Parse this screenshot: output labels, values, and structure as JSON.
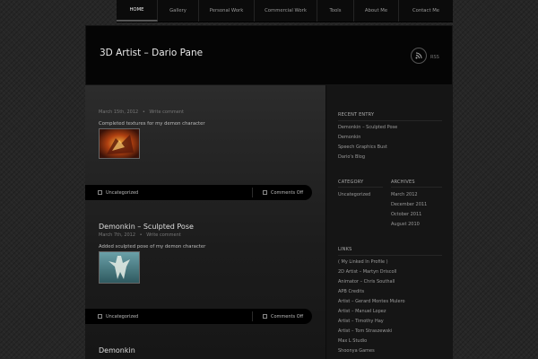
{
  "nav": {
    "items": [
      {
        "label": "HOME",
        "active": true
      },
      {
        "label": "Gallery",
        "active": false
      },
      {
        "label": "Personal Work",
        "active": false
      },
      {
        "label": "Commercial Work",
        "active": false
      },
      {
        "label": "Tools",
        "active": false
      },
      {
        "label": "About Me",
        "active": false
      },
      {
        "label": "Contact Me",
        "active": false
      }
    ]
  },
  "header": {
    "site_title": "3D Artist – Dario Pane",
    "rss_label": "RSS"
  },
  "posts": [
    {
      "title": "",
      "date": "March 15th, 2012",
      "comment_link": "Write comment",
      "excerpt": "Completed textures for my demon character",
      "thumb_icon": "demon-character-thumbnail",
      "category": "Uncategorized",
      "comments": "Comments Off"
    },
    {
      "title": "Demonkin – Sculpted Pose",
      "date": "March 7th, 2012",
      "comment_link": "Write comment",
      "excerpt": "Added sculpted pose of my demon character",
      "thumb_icon": "sculpted-pose-thumbnail",
      "category": "Uncategorized",
      "comments": "Comments Off"
    },
    {
      "title": "Demonkin"
    }
  ],
  "sidebar": {
    "recent_entry": {
      "heading": "RECENT ENTRY",
      "items": [
        "Demonkin – Sculpted Pose",
        "Demonkin",
        "Speech Graphics Bust",
        "Dario's Blog"
      ]
    },
    "category": {
      "heading": "CATEGORY",
      "items": [
        "Uncategorized"
      ]
    },
    "archives": {
      "heading": "ARCHIVES",
      "items": [
        "March 2012",
        "December 2011",
        "October 2011",
        "August 2010"
      ]
    },
    "links": {
      "heading": "LINKS",
      "items": [
        "( My Linked In Profile )",
        "2D Artist – Martyn Driscoll",
        "Animator – Chris Southall",
        "APB Credits",
        "Artist – Gerard Montes Mulero",
        "Artist – Manuel Lopez",
        "Artist – Timothy Hay",
        "Artist – Tom Straszewski",
        "Max L Studio",
        "Shoonya Games"
      ]
    }
  },
  "colors": {
    "background": "#262626",
    "nav_bg": "#0b0b0b",
    "header_bg": "#050505",
    "sidebar_bg": "#151515",
    "footbar_bg": "#000000"
  }
}
